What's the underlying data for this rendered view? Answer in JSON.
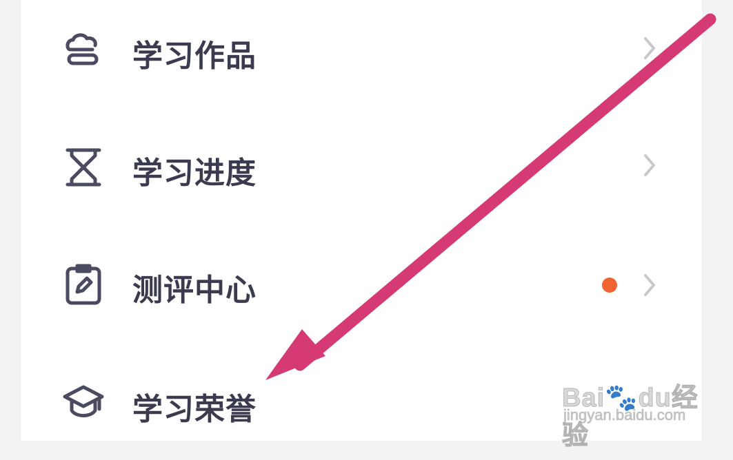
{
  "menu": {
    "items": [
      {
        "label": "学习作品",
        "icon": "cloud-icon",
        "has_dot": false
      },
      {
        "label": "学习进度",
        "icon": "hourglass-icon",
        "has_dot": false
      },
      {
        "label": "测评中心",
        "icon": "clipboard-edit-icon",
        "has_dot": true
      },
      {
        "label": "学习荣誉",
        "icon": "graduation-cap-icon",
        "has_dot": false
      }
    ]
  },
  "colors": {
    "text": "#3b3b50",
    "icon": "#4a4a60",
    "chevron": "#c8c8ce",
    "notification_dot": "#f26332",
    "annotation_arrow": "#d63a74"
  },
  "watermark": {
    "brand": "Bai🐾du经验",
    "url": "jingyan.baidu.com"
  }
}
